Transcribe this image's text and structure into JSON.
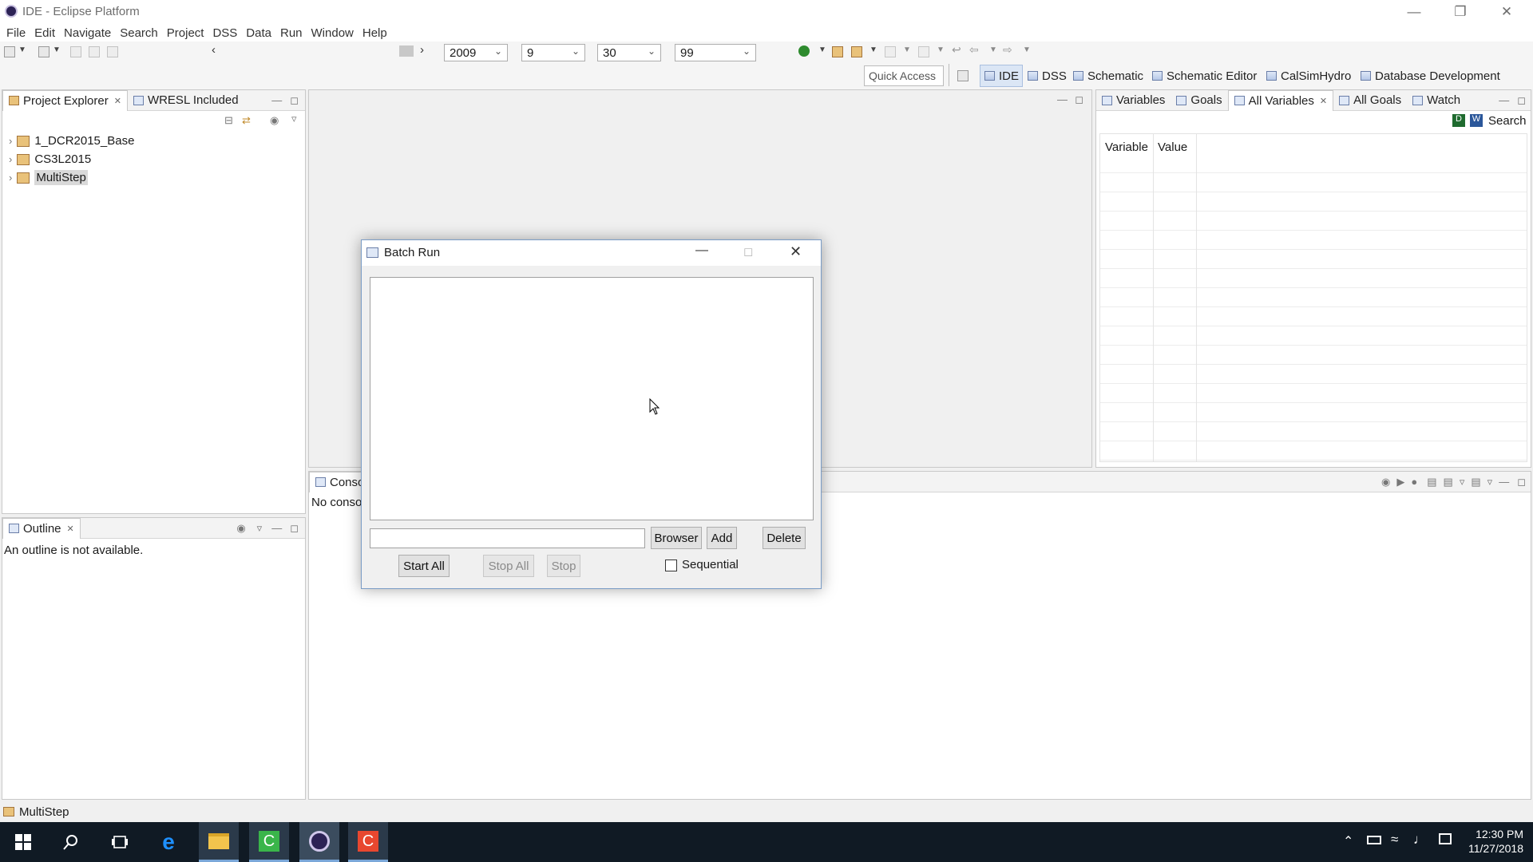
{
  "window": {
    "title": "IDE - Eclipse Platform"
  },
  "menu": [
    "File",
    "Edit",
    "Navigate",
    "Search",
    "Project",
    "DSS",
    "Data",
    "Run",
    "Window",
    "Help"
  ],
  "toolbar": {
    "year": "2009",
    "month": "9",
    "day": "30",
    "period": "99",
    "quick_access_placeholder": "Quick Access"
  },
  "perspectives": [
    "IDE",
    "DSS",
    "Schematic",
    "Schematic Editor",
    "CalSimHydro",
    "Database Development"
  ],
  "left_panel": {
    "tabs": [
      "Project Explorer",
      "WRESL Included"
    ],
    "projects": [
      "1_DCR2015_Base",
      "CS3L2015",
      "MultiStep"
    ],
    "selected": "MultiStep"
  },
  "outline": {
    "tab": "Outline",
    "message": "An outline is not available."
  },
  "right_panel": {
    "tabs": [
      "Variables",
      "Goals",
      "All Variables",
      "All Goals",
      "Watch"
    ],
    "search_label": "Search",
    "columns": [
      "Variable",
      "Value"
    ]
  },
  "console": {
    "tab": "Conso",
    "message": "No conso"
  },
  "dialog": {
    "title": "Batch Run",
    "input_value": "",
    "browser_label": "Browser",
    "add_label": "Add",
    "delete_label": "Delete",
    "start_all_label": "Start All",
    "stop_all_label": "Stop All",
    "stop_label": "Stop",
    "sequential_label": "Sequential",
    "sequential_checked": false
  },
  "status_bar": {
    "text": "MultiStep"
  },
  "taskbar": {
    "time": "12:30 PM",
    "date": "11/27/2018"
  }
}
